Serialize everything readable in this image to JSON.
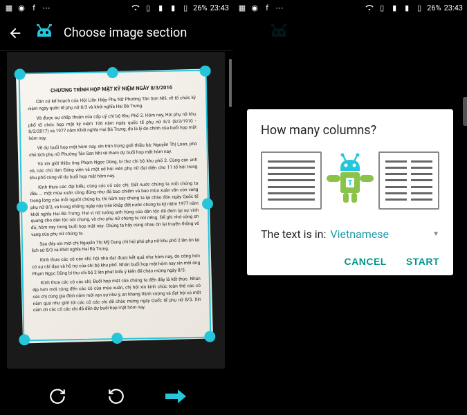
{
  "status": {
    "battery": "26%",
    "time": "23:43"
  },
  "left": {
    "title": "Choose image section"
  },
  "doc": {
    "title": "CHƯƠNG TRÌNH HỌP MẶT KỶ NIỆM NGÀY 8/3/2016",
    "p1": "Căn cứ kế hoạch của Hội Liên Hiệp Phụ Nữ Phường Tân Sơn Nhì, về tổ chức kỷ niệm ngày quốc tế phụ nữ 8/3 và khởi nghĩa Hai Bà Trưng.",
    "p2": "Và được sự chấp thuận của cấp uỷ chi bộ Khu Phố 2. Hôm nay, Hội phụ nữ khu phố tổ chức họp mặt kỷ niệm 106 năm ngày quốc tế phụ nữ 8/3 (8/3/1910 - 8/3/2017) và 1977 năm Khởi nghĩa Hai Bà Trưng, đó là lý do chính của buổi họp mặt hôm nay.",
    "p3": "Về dự buổi họp mặt hôm nay, xin trân trọng giới thiệu bà: Nguyễn Thị Loan, phó chủ tịch phụ nữ Phường Tân Sơn Nhì về tham dự buổi họp mặt hôm nay.",
    "p4": "Và xin giới thiệu ông Phạm Ngọc Dũng, bí thư chi bộ khu phố 2. Cùng các anh cô, các chú làm Đảng viên và một số hội viên phụ nữ đại diện cho 11 tổ hội trong khu phố cùng về dự buổi họp mặt hôm nay.",
    "p5": "Kính thưa các đại biểu, cùng các cô các chị. Đất nước chúng ta mỗi chúng ta đều ... một mùa xuân công đúng như đã bao chiếm và bao mùa xuân văn còn vang trong lòng của mỗi người chúng ta, thì hôm nay chúng ta lại chào đón ngày Quốc tế phụ nữ 8/3, và trong những ngày này trên khắp đất nước chúng ta kỷ niệm 1977 năm khởi nghĩa Hai Bà Trưng. Hai vị nữ tướng anh hùng của dân tộc đã đem lại sự vinh quang cho dân tộc nói chung, và cho phụ nữ chúng ta nói riêng. Để ghi nhớ công ơn đó, hôm nay trong buổi họp mặt này. Chúng ta hãy cùng nhau ôn lại truyền thống vẻ vang của phụ nữ chúng ta.",
    "p6": "Sau đây xin mời chị Nguyễn Thị Mỹ Dung chi hội phó phụ nữ khu phố 2 lên ôn lại lịch sử 8/3 và Khởi nghĩa Hai Bà Trưng.",
    "p7": "Kính thưa các cô các chị: hội nhà đạt được kết quả như hôm nay, do công hơn có sự chỉ đạo và hỗ trợ của chi bộ khu phố. Nhân buổi họp mặt hôm nay xin mời ông Phạm Ngọc Dũng bí thư chi bộ 2 lên phát biểu ý kiến để chào mừng ngày 8/3.",
    "p8": "Kính thưa các cô các chị: Buổi họp mặt của chúng ta đến đây là kết thúc. Nhân dịp hơn mới cùng đến các cô của mùa xuân, chị hội xin kính chúc toàn thể các cô các chị cùng gia đình năm mới vạn sự như ý, an khang thịnh vượng và đạt hội có một năm quá như giới tới các cô các chị để chào mừng ngày Quốc tế phụ nữ 8/3. Xin cảm ơn các cô các chị đã đến dự buổi họp mặt hôm nay."
  },
  "dialog": {
    "title": "How many columns?",
    "lang_prefix": "The text is in:",
    "lang_value": "Vietnamese",
    "cancel": "CANCEL",
    "start": "START"
  },
  "colors": {
    "accent_crop": "#26c6da",
    "accent_text": "#1a9ba8",
    "button": "#009688"
  }
}
